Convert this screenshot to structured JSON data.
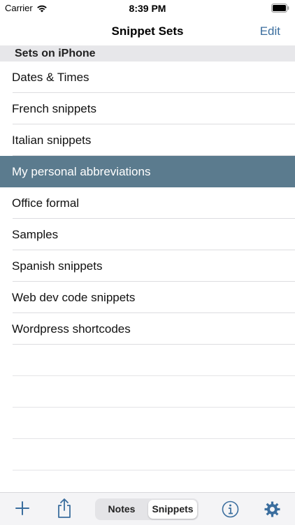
{
  "status_bar": {
    "carrier": "Carrier",
    "time": "8:39 PM"
  },
  "nav": {
    "title": "Snippet Sets",
    "edit_label": "Edit"
  },
  "section": {
    "header": "Sets on iPhone"
  },
  "snippet_sets": [
    {
      "label": "Dates & Times",
      "selected": false
    },
    {
      "label": "French snippets",
      "selected": false
    },
    {
      "label": "Italian snippets",
      "selected": false
    },
    {
      "label": "My personal abbreviations",
      "selected": true
    },
    {
      "label": "Office formal",
      "selected": false
    },
    {
      "label": "Samples",
      "selected": false
    },
    {
      "label": "Spanish snippets",
      "selected": false
    },
    {
      "label": "Web dev code snippets",
      "selected": false
    },
    {
      "label": "Wordpress shortcodes",
      "selected": false
    }
  ],
  "toolbar": {
    "add_icon": "plus-icon",
    "share_icon": "share-icon",
    "segments": [
      {
        "label": "Notes",
        "selected": false
      },
      {
        "label": "Snippets",
        "selected": true
      }
    ],
    "info_icon": "info-icon",
    "settings_icon": "gear-icon"
  },
  "colors": {
    "accent": "#3b6e9e",
    "selection": "#5b7b8e",
    "section_bg": "#e7e7ea"
  }
}
